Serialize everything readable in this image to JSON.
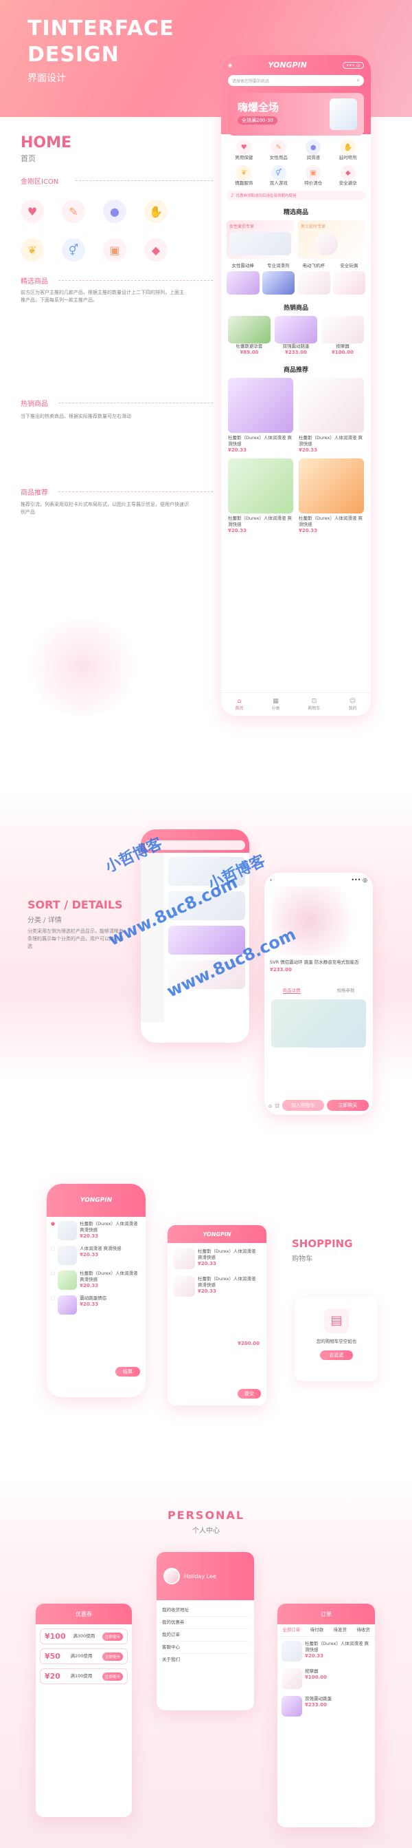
{
  "header": {
    "title_line1": "TINTERFACE",
    "title_line2": "DESIGN",
    "subtitle": "界面设计"
  },
  "home": {
    "title": "HOME",
    "subtitle": "首页",
    "icon_section": "金刚区ICON",
    "icons": [
      "heart-lips-icon",
      "tongue-icon",
      "drop-icon",
      "hand-icon",
      "wings-icon",
      "gender-icon",
      "ticket-icon",
      "box-icon"
    ],
    "featured_label": "精选商品",
    "featured_desc": "前方区为客户主推的几款产品，根据主推的数量设计上二下四的排列，上面主推产品，下面每系列一款主推产品。",
    "hot_label": "热销商品",
    "hot_desc": "当下推出的热卖商品，根据实际推荐数量可左右滑动",
    "rec_label": "商品推荐",
    "rec_desc": "推荐引流，列表采用双栏卡片式布局形式，以图片主导展示信息，便用户快速识别产品"
  },
  "phone_home": {
    "brand": "YONGPIN",
    "search_placeholder": "请搜索您想要的商品",
    "banner_title": "嗨爆全场",
    "banner_sub": "全场满200-30",
    "categories": [
      "男用保健",
      "女性用品",
      "润滑液",
      "延时喷剂",
      "情趣服饰",
      "双人游戏",
      "特价清仓",
      "安全避孕"
    ],
    "notice": "优惠券领取成功后请在有效期内使用",
    "featured_title": "精选商品",
    "featured_cards": [
      "女性爱侣专享",
      "男士延时专享"
    ],
    "featured_items": [
      "女性震动棒",
      "专业润滑剂",
      "电动飞机杯",
      "安全玩偶"
    ],
    "hot_title": "热销商品",
    "hot_items": [
      {
        "name": "杜蕾斯避孕套",
        "price": "¥89.00"
      },
      {
        "name": "双强震动跳蛋",
        "price": "¥233.00"
      },
      {
        "name": "按摩器",
        "price": "¥100.00"
      }
    ],
    "rec_title": "商品推荐",
    "rec_items": [
      {
        "name": "杜蕾斯（Durex）人体润滑液 爽滑快感",
        "price": "¥20.33"
      },
      {
        "name": "杜蕾斯（Durex）人体润滑液 爽滑快感",
        "price": "¥20.33"
      },
      {
        "name": "杜蕾斯（Durex）人体润滑液 爽滑快感",
        "price": "¥20.33"
      },
      {
        "name": "杜蕾斯（Durex）人体润滑液 爽滑快感",
        "price": "¥20.33"
      }
    ],
    "tabs": [
      "首页",
      "分类",
      "购物车",
      "我的"
    ]
  },
  "sort": {
    "title": "SORT / DETAILS",
    "subtitle": "分类 / 详情",
    "desc": "分类采用左侧为筛选栏产品显示，能够清晰有条理的展示每个分类的产品，用户可以随时筛选"
  },
  "detail": {
    "product": "SVR 情侣震动环 跳蛋 防水静音充电式智能舌",
    "price": "¥233.00",
    "tabs": [
      "商品详情",
      "规格参数"
    ],
    "add_cart": "加入购物车",
    "buy_now": "立即购买"
  },
  "shopping": {
    "title": "SHOPPING",
    "subtitle": "购物车",
    "items": [
      {
        "name": "杜蕾斯（Durex）人体润滑液 爽滑快感",
        "price": "¥20.33"
      },
      {
        "name": "人体润滑液 爽滑快感",
        "price": "¥20.33"
      },
      {
        "name": "杜蕾斯（Durex）人体润滑液 爽滑快感",
        "price": "¥20.33"
      },
      {
        "name": "震动跳蛋情侣",
        "price": "¥20.33"
      }
    ],
    "checkout": "结算",
    "empty_text": "您的购物车空空如也",
    "go_shop": "去逛逛",
    "total": "合计：¥200.00",
    "order_items": [
      {
        "name": "杜蕾斯（Durex）人体润滑液 爽滑快感",
        "price": "¥20.33"
      },
      {
        "name": "杜蕾斯（Durex）人体润滑液 爽滑快感",
        "price": "¥20.33"
      }
    ],
    "submit": "提交",
    "order_price": "¥200.00"
  },
  "personal": {
    "title": "PERSONAL",
    "subtitle": "个人中心",
    "user": "Holiday Lee",
    "menu": [
      "我的收货地址",
      "我的优惠券",
      "我的订单",
      "客服中心",
      "关于我们"
    ],
    "coupons": [
      {
        "amount": "¥100",
        "desc": "满300使用"
      },
      {
        "amount": "¥50",
        "desc": "满200使用"
      },
      {
        "amount": "¥20",
        "desc": "满100使用"
      }
    ],
    "coupon_btn": "立即使用",
    "coupon_title": "优惠券",
    "orders_title": "订单",
    "order_tabs": [
      "全部订单",
      "待付款",
      "待发货",
      "待收货"
    ]
  },
  "watermarks": [
    "小哲博客",
    "www.8uc8.com"
  ],
  "colors": {
    "accent": "#f06a8c",
    "header_grad_start": "#ffa9a9",
    "header_grad_end": "#fbb7c7"
  }
}
